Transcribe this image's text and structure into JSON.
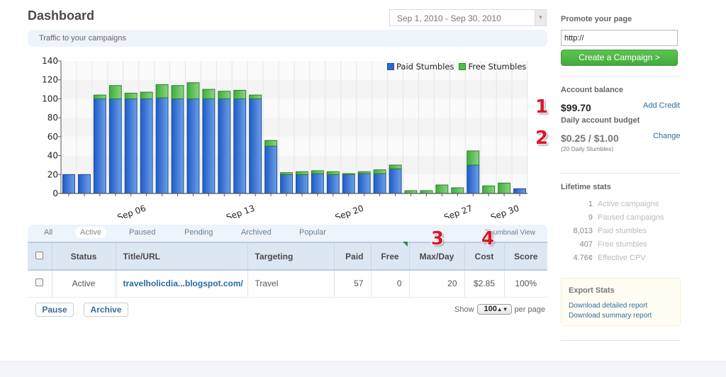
{
  "header": {
    "title": "Dashboard",
    "date_range": "Sep 1, 2010 - Sep 30, 2010",
    "traffic_label": "Traffic to your campaigns"
  },
  "chart_data": {
    "type": "bar",
    "stacked": true,
    "title": "",
    "xlabel": "",
    "ylabel": "",
    "ylim": [
      0,
      140
    ],
    "yticks": [
      0,
      20,
      40,
      60,
      80,
      100,
      120,
      140
    ],
    "grid": true,
    "legend_position": "top-right",
    "categories": [
      "Sep 01",
      "Sep 02",
      "Sep 03",
      "Sep 04",
      "Sep 05",
      "Sep 06",
      "Sep 07",
      "Sep 08",
      "Sep 09",
      "Sep 10",
      "Sep 11",
      "Sep 12",
      "Sep 13",
      "Sep 14",
      "Sep 15",
      "Sep 16",
      "Sep 17",
      "Sep 18",
      "Sep 19",
      "Sep 20",
      "Sep 21",
      "Sep 22",
      "Sep 23",
      "Sep 24",
      "Sep 25",
      "Sep 26",
      "Sep 27",
      "Sep 28",
      "Sep 29",
      "Sep 30"
    ],
    "xtick_labels": [
      {
        "index": 5,
        "label": "Sep 06"
      },
      {
        "index": 12,
        "label": "Sep 13"
      },
      {
        "index": 19,
        "label": "Sep 20"
      },
      {
        "index": 26,
        "label": "Sep 27"
      },
      {
        "index": 29,
        "label": "Sep 30"
      }
    ],
    "series": [
      {
        "name": "Paid Stumbles",
        "color": "#2a6ad6",
        "values": [
          20,
          20,
          100,
          100,
          100,
          100,
          101,
          100,
          100,
          100,
          100,
          100,
          100,
          50,
          20,
          20,
          21,
          20,
          20,
          21,
          21,
          26,
          0,
          0,
          0,
          0,
          30,
          0,
          0,
          5
        ]
      },
      {
        "name": "Free Stumbles",
        "color": "#4fbf4a",
        "values": [
          0,
          0,
          4,
          14,
          6,
          7,
          14,
          14,
          17,
          10,
          8,
          9,
          4,
          6,
          2,
          3,
          3,
          3,
          1,
          2,
          4,
          4,
          3,
          3,
          9,
          6,
          15,
          8,
          11,
          0
        ]
      }
    ]
  },
  "tabs": {
    "items": [
      "All",
      "Active",
      "Paused",
      "Pending",
      "Archived",
      "Popular"
    ],
    "selected": "Active",
    "thumbnail_view": "Thumbnail View"
  },
  "table": {
    "columns": [
      "",
      "Status",
      "Title/URL",
      "Targeting",
      "Paid",
      "Free",
      "Max/Day",
      "Cost",
      "Score"
    ],
    "rows": [
      {
        "status": "Active",
        "title": "travelholicdia...blogspot.com/",
        "targeting": "Travel",
        "paid": "57",
        "free": "0",
        "max_day": "20",
        "cost": "$2.85",
        "score": "100%"
      }
    ]
  },
  "actions": {
    "pause": "Pause",
    "archive": "Archive",
    "show_label": "Show",
    "per_page_value": "100",
    "per_page_label": "per page"
  },
  "annotations": [
    "1",
    "2",
    "3",
    "4"
  ],
  "sidebar": {
    "promote_heading": "Promote your page",
    "url_value": "http://",
    "create_button": "Create a Campaign >",
    "balance_heading": "Account balance",
    "balance_value": "$99.70",
    "add_credit": "Add Credit",
    "budget_heading": "Daily account budget",
    "budget_value": "$0.25 / $1.00",
    "budget_sub": "(20 Daily Stumbles)",
    "change": "Change",
    "lifetime_heading": "Lifetime stats",
    "lifetime_stats": [
      {
        "value": "1",
        "label": "Active campaigns"
      },
      {
        "value": "9",
        "label": "Paused campaigns"
      },
      {
        "value": "8,013",
        "label": "Paid stumbles"
      },
      {
        "value": "407",
        "label": "Free stumbles"
      },
      {
        "value": "4.76¢",
        "label": "Effective CPV"
      }
    ],
    "export_heading": "Export Stats",
    "export_links": [
      "Download detailed report",
      "Download summary report"
    ]
  }
}
